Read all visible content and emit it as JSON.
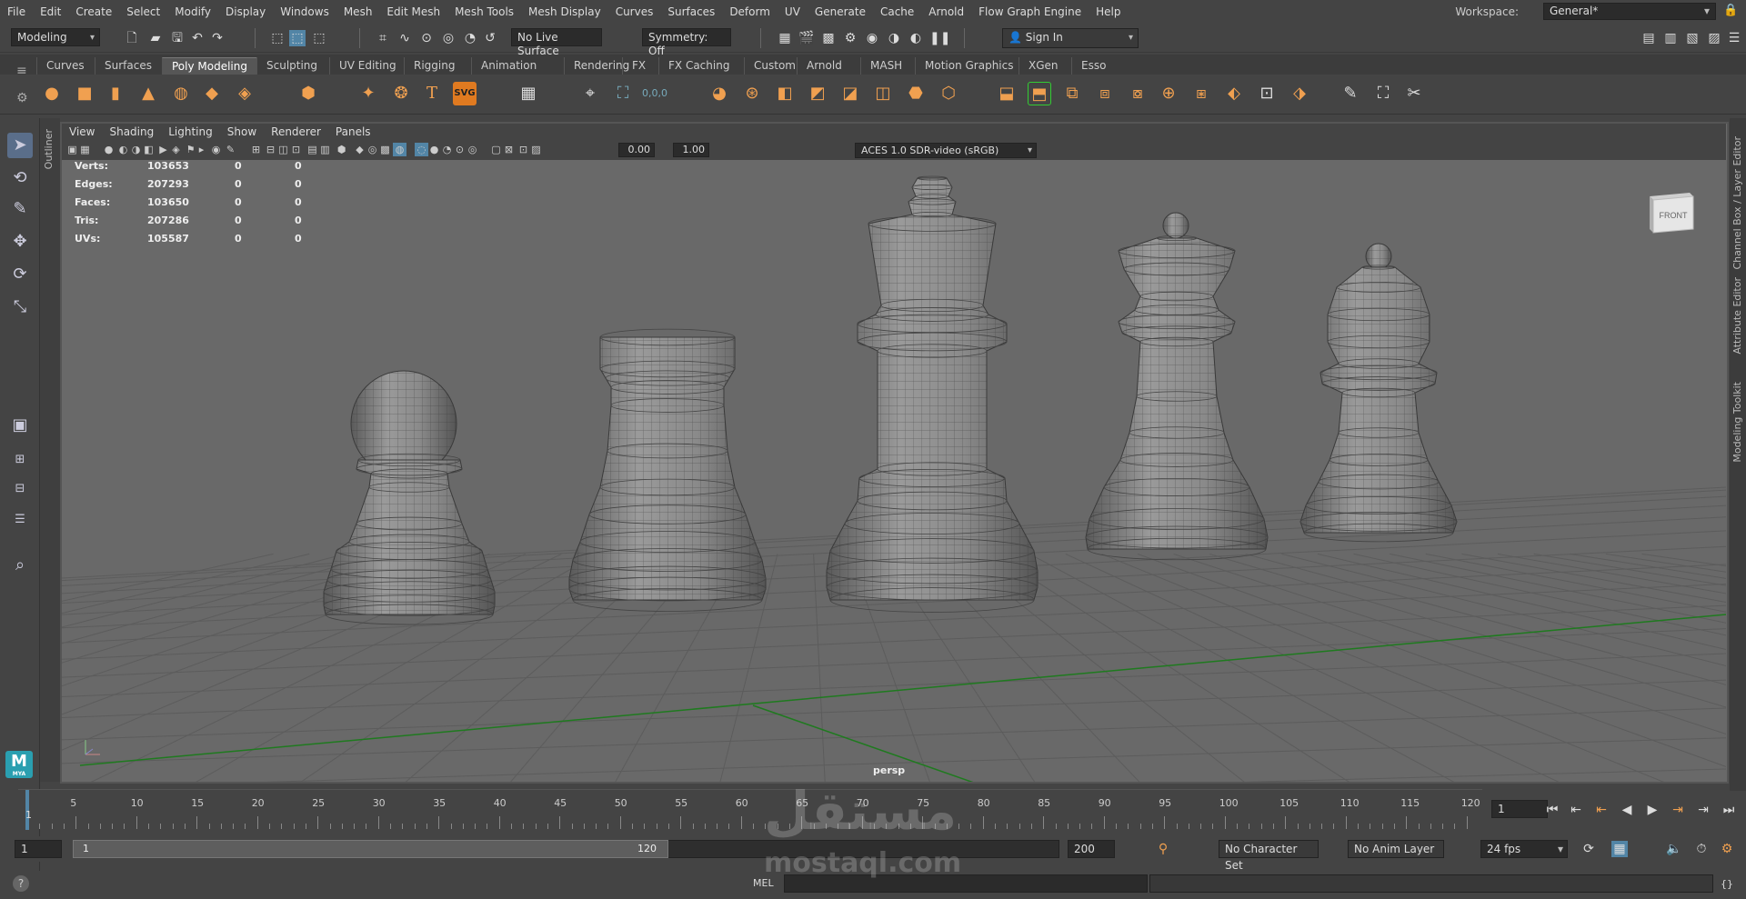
{
  "menu": [
    "File",
    "Edit",
    "Create",
    "Select",
    "Modify",
    "Display",
    "Windows",
    "Mesh",
    "Edit Mesh",
    "Mesh Tools",
    "Mesh Display",
    "Curves",
    "Surfaces",
    "Deform",
    "UV",
    "Generate",
    "Cache",
    "Arnold",
    "Flow Graph Engine",
    "Help"
  ],
  "workspace": {
    "label": "Workspace:",
    "value": "General*"
  },
  "status": {
    "mode": "Modeling",
    "live_surface": "No Live Surface",
    "symmetry": "Symmetry: Off",
    "sign_in": "Sign In"
  },
  "shelf_tabs": [
    "Curves",
    "Surfaces",
    "Poly Modeling",
    "Sculpting",
    "UV Editing",
    "Rigging",
    "Animation",
    "Rendering",
    "FX",
    "FX Caching",
    "Custom",
    "Arnold",
    "MASH",
    "Motion Graphics",
    "XGen",
    "Esso"
  ],
  "shelf_active": "Poly Modeling",
  "panel_menu": [
    "View",
    "Shading",
    "Lighting",
    "Show",
    "Renderer",
    "Panels"
  ],
  "panel_fields": {
    "exposure": "0.00",
    "gamma": "1.00",
    "colorspace": "ACES 1.0 SDR-video (sRGB)"
  },
  "hud": [
    {
      "label": "Verts:",
      "value": "103653",
      "sel": "0",
      "comp": "0"
    },
    {
      "label": "Edges:",
      "value": "207293",
      "sel": "0",
      "comp": "0"
    },
    {
      "label": "Faces:",
      "value": "103650",
      "sel": "0",
      "comp": "0"
    },
    {
      "label": "Tris:",
      "value": "207286",
      "sel": "0",
      "comp": "0"
    },
    {
      "label": "UVs:",
      "value": "105587",
      "sel": "0",
      "comp": "0"
    }
  ],
  "camera_label": "persp",
  "viewcube_face": "FRONT",
  "outliner_tab": "Outliner",
  "right_tabs": [
    "Channel Box / Layer Editor",
    "Attribute Editor",
    "Modeling Toolkit"
  ],
  "timeline": {
    "ticks": [
      "5",
      "10",
      "15",
      "20",
      "25",
      "30",
      "35",
      "40",
      "45",
      "50",
      "55",
      "60",
      "65",
      "70",
      "75",
      "80",
      "85",
      "90",
      "95",
      "100",
      "105",
      "110",
      "115",
      "120"
    ],
    "current_frame": "1",
    "start_marker": "1"
  },
  "range": {
    "start": "1",
    "inner_start": "1",
    "inner_end": "120",
    "end": "200",
    "character_set": "No Character Set",
    "anim_layer": "No Anim Layer",
    "fps": "24 fps"
  },
  "command": {
    "label": "MEL"
  },
  "watermark": {
    "arabic": "مستقل",
    "latin": "mostaql.com"
  },
  "logo": {
    "letter": "M",
    "sub": "MYA"
  },
  "colors": {
    "accent": "#5285a6",
    "orange": "#f0a050",
    "viewport_bg": "#696969",
    "grid_axis": "#1f7a1f"
  }
}
